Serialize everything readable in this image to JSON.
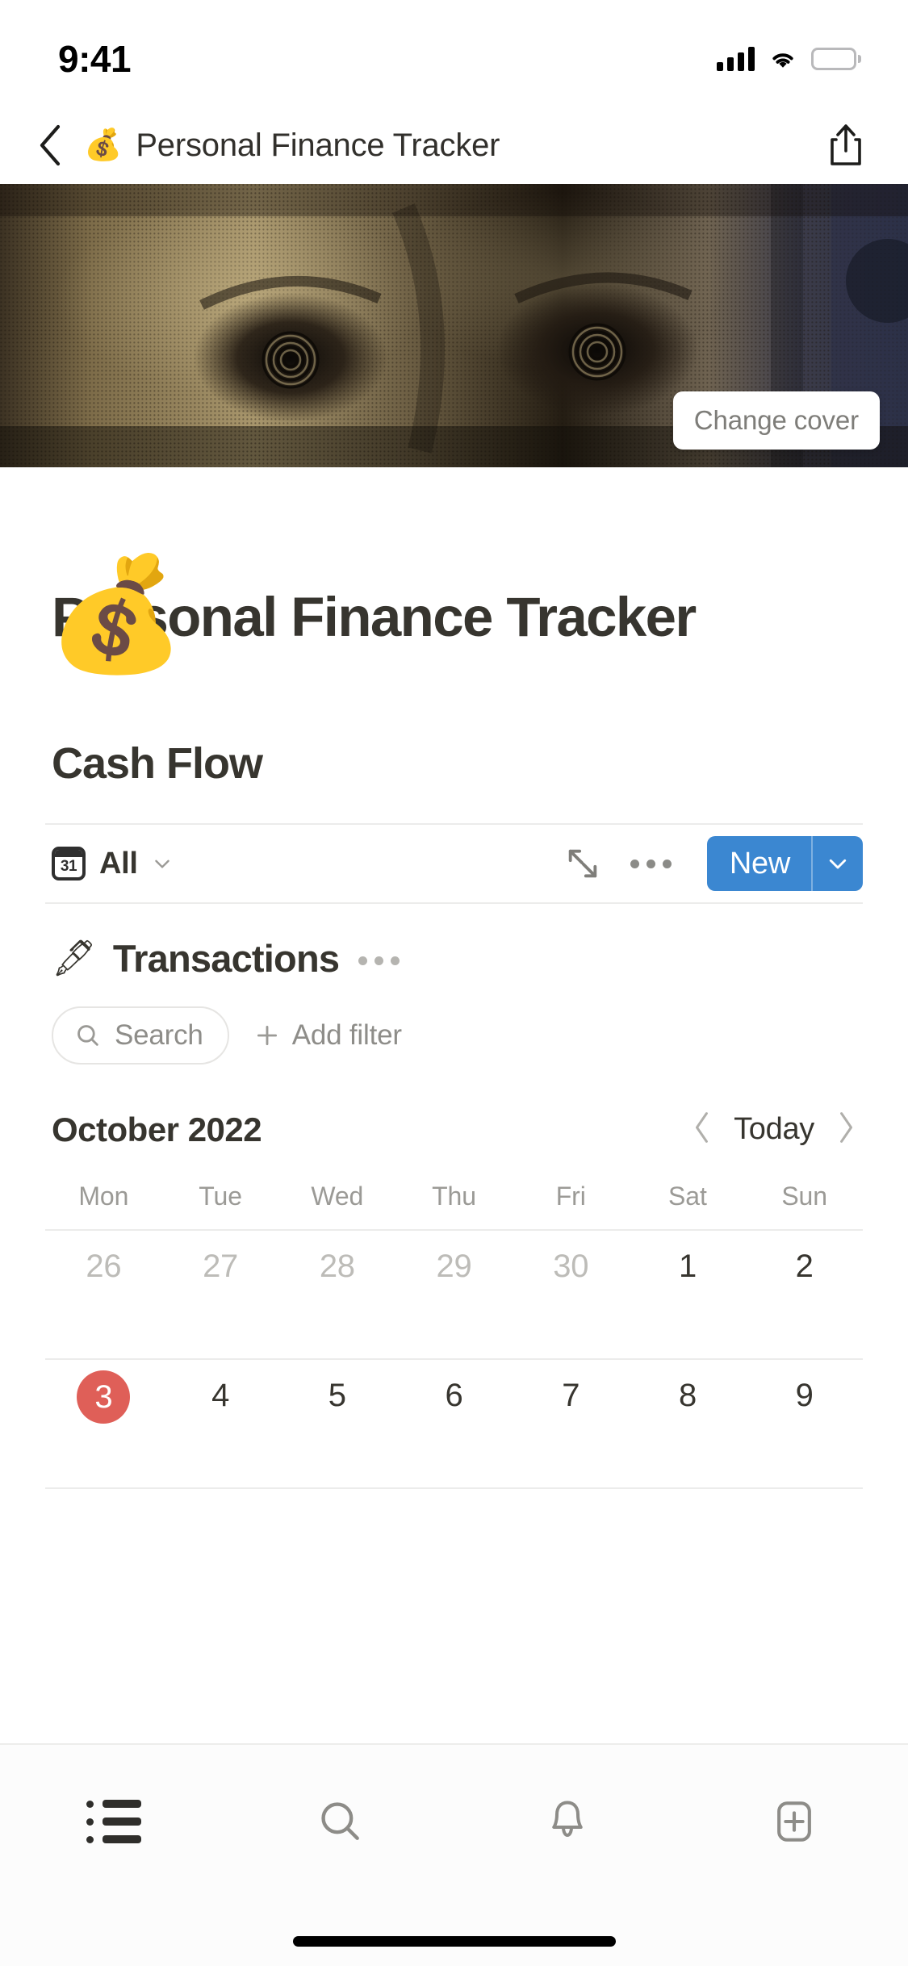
{
  "status_bar": {
    "time": "9:41",
    "signal_icon": "cellular-signal-icon",
    "wifi_icon": "wifi-icon",
    "battery_icon": "battery-full-icon"
  },
  "nav_bar": {
    "back_icon": "chevron-left-icon",
    "emoji": "💰",
    "title": "Personal Finance Tracker",
    "share_icon": "share-icon"
  },
  "cover": {
    "change_cover_label": "Change cover",
    "description": "hundred-dollar-bill-macro-photo"
  },
  "page": {
    "emoji": "💰",
    "title": "Personal Finance Tracker"
  },
  "section": {
    "heading": "Cash Flow"
  },
  "db_toolbar": {
    "view_icon": "calendar-icon",
    "view_icon_day": "31",
    "view_name": "All",
    "view_chevron_icon": "chevron-down-icon",
    "expand_icon": "expand-diagonal-icon",
    "more_icon": "ellipsis-icon",
    "new_label": "New",
    "new_caret_icon": "chevron-down-icon",
    "accent_color": "#3b87d1"
  },
  "transactions": {
    "emoji": "🖋",
    "title": "Transactions",
    "more_icon": "ellipsis-icon",
    "search_icon": "search-icon",
    "search_placeholder": "Search",
    "add_filter_icon": "plus-icon",
    "add_filter_label": "Add filter"
  },
  "calendar": {
    "month_label": "October 2022",
    "prev_icon": "chevron-left-icon",
    "today_label": "Today",
    "next_icon": "chevron-right-icon",
    "weekdays": [
      "Mon",
      "Tue",
      "Wed",
      "Thu",
      "Fri",
      "Sat",
      "Sun"
    ],
    "today_highlight_color": "#df5f58",
    "rows": [
      [
        {
          "day": "26",
          "muted": true
        },
        {
          "day": "27",
          "muted": true
        },
        {
          "day": "28",
          "muted": true
        },
        {
          "day": "29",
          "muted": true
        },
        {
          "day": "30",
          "muted": true
        },
        {
          "day": "1",
          "muted": false
        },
        {
          "day": "2",
          "muted": false
        }
      ],
      [
        {
          "day": "3",
          "muted": false,
          "today": true
        },
        {
          "day": "4",
          "muted": false
        },
        {
          "day": "5",
          "muted": false
        },
        {
          "day": "6",
          "muted": false
        },
        {
          "day": "7",
          "muted": false
        },
        {
          "day": "8",
          "muted": false
        },
        {
          "day": "9",
          "muted": false
        }
      ]
    ]
  },
  "tab_bar": {
    "items": [
      {
        "icon": "list-icon",
        "active": true
      },
      {
        "icon": "search-icon",
        "active": false
      },
      {
        "icon": "bell-icon",
        "active": false
      },
      {
        "icon": "new-page-icon",
        "active": false
      }
    ]
  }
}
